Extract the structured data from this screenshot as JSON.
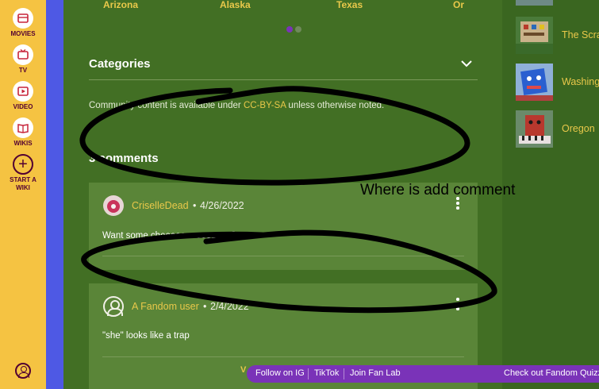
{
  "global_nav": {
    "items": [
      {
        "label": "MOVIES",
        "icon": "movies-icon"
      },
      {
        "label": "TV",
        "icon": "tv-icon"
      },
      {
        "label": "VIDEO",
        "icon": "video-icon"
      },
      {
        "label": "WIKIS",
        "icon": "wikis-icon"
      },
      {
        "label": "START A\nWIKI",
        "icon": "plus-icon"
      }
    ],
    "colors": {
      "background": "#f5c342",
      "label": "#520032",
      "icon": "#c7243a"
    }
  },
  "carousel": {
    "states": [
      "Arizona",
      "Alaska",
      "Texas",
      "Or"
    ],
    "active_dot": 0
  },
  "categories": {
    "title": "Categories"
  },
  "license": {
    "prefix": "Community content is available under ",
    "link": "CC-BY-SA",
    "suffix": " unless otherwise noted."
  },
  "comments": {
    "title": "3 comments",
    "items": [
      {
        "user": "CriselleDead",
        "separator": "•",
        "date": "4/26/2022",
        "body": "Want some cheeeeeeeeeeeese?"
      },
      {
        "user": "A Fandom user",
        "separator": "•",
        "date": "2/4/2022",
        "body": "\"she\" looks like a trap"
      }
    ]
  },
  "right_rail": {
    "items": [
      {
        "label": "The Scra"
      },
      {
        "label": "Washing"
      },
      {
        "label": "Oregon"
      }
    ]
  },
  "annotation": {
    "note": "Where is add comment"
  },
  "bottom_bar": {
    "items": [
      "Follow on IG",
      "TikTok",
      "Join Fan Lab",
      "Check out Fandom Quizz"
    ],
    "peek": "V"
  },
  "colors": {
    "accent": "#e9c84a",
    "page_bg": "#426f24",
    "fandom_blue": "#4e59e4",
    "bar_purple": "#7a33b8",
    "dot_active": "#7a33b8"
  }
}
